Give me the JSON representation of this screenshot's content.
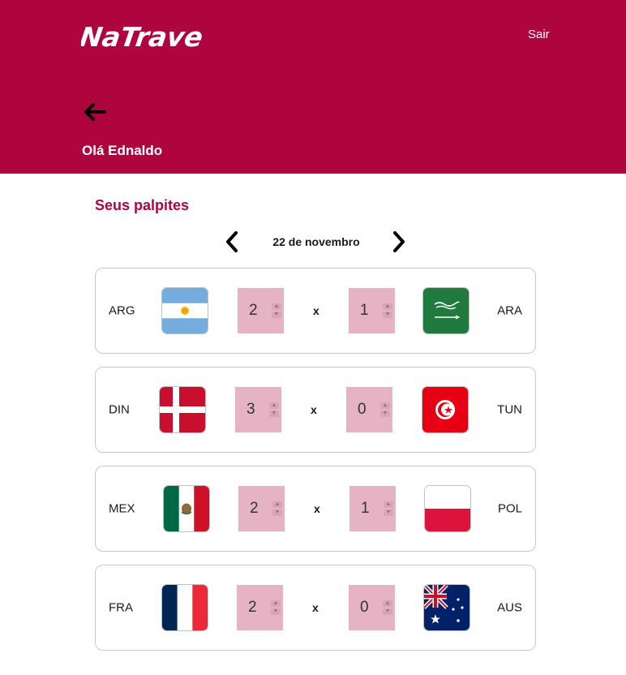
{
  "header": {
    "brand": "NaTrave",
    "logout_label": "Sair",
    "greeting": "Olá Ednaldo",
    "background": "#AF053F"
  },
  "content": {
    "title": "Seus palpites",
    "date_label": "22 de novembro",
    "separator": "x",
    "accent_color": "#AF053F",
    "input_color": "#E5B3C3"
  },
  "matches": [
    {
      "home": {
        "code": "ARG",
        "flag": "argentina-flag"
      },
      "home_score": "2",
      "away_score": "1",
      "away": {
        "code": "ARA",
        "flag": "saudi-arabia-flag"
      }
    },
    {
      "home": {
        "code": "DIN",
        "flag": "denmark-flag"
      },
      "home_score": "3",
      "away_score": "0",
      "away": {
        "code": "TUN",
        "flag": "tunisia-flag"
      }
    },
    {
      "home": {
        "code": "MEX",
        "flag": "mexico-flag"
      },
      "home_score": "2",
      "away_score": "1",
      "away": {
        "code": "POL",
        "flag": "poland-flag"
      }
    },
    {
      "home": {
        "code": "FRA",
        "flag": "france-flag"
      },
      "home_score": "2",
      "away_score": "0",
      "away": {
        "code": "AUS",
        "flag": "australia-flag"
      }
    }
  ]
}
